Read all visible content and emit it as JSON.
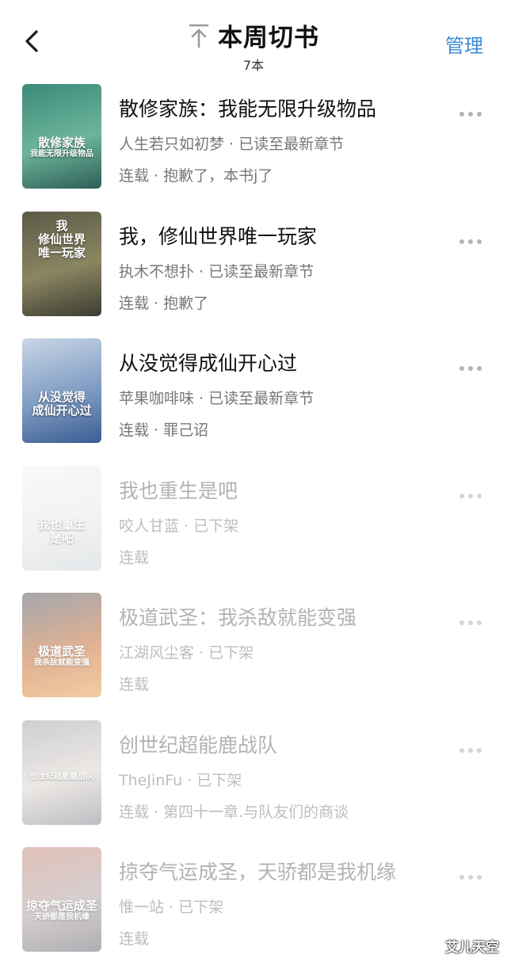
{
  "header": {
    "title": "本周切书",
    "subtitle": "7本",
    "manage_label": "管理"
  },
  "books": [
    {
      "title": "散修家族：我能无限升级物品",
      "meta": "人生若只如初梦 · 已读至最新章节",
      "status": "连载 · 抱歉了，本书j了",
      "cover": {
        "colors": [
          "#3c8a7a",
          "#6cb59a",
          "#2f5e57"
        ],
        "lines": [
          "散修家族",
          "我能无限升级物品"
        ]
      },
      "available": true
    },
    {
      "title": "我，修仙世界唯一玩家",
      "meta": "执木不想扑 · 已读至最新章节",
      "status": "连载 · 抱歉了",
      "cover": {
        "colors": [
          "#5b5a47",
          "#8a8662",
          "#3d3c30"
        ],
        "lines": [
          "我",
          "修仙世界",
          "唯一玩家"
        ]
      },
      "available": true
    },
    {
      "title": "从没觉得成仙开心过",
      "meta": "苹果咖啡味 · 已读至最新章节",
      "status": "连载 · 罪己诏",
      "cover": {
        "colors": [
          "#c9d6e6",
          "#7f9cc3",
          "#3b5d93"
        ],
        "lines": [
          "从没觉得",
          "成仙开心过"
        ]
      },
      "available": true
    },
    {
      "title": "我也重生是吧",
      "meta": "咬人甘蓝 · 已下架",
      "status": "连载",
      "cover": {
        "colors": [
          "#f2f3f4",
          "#e7e9eb",
          "#cfd4d8"
        ],
        "lines": [
          "我也重生",
          "是吧"
        ]
      },
      "available": false
    },
    {
      "title": "极道武圣：我杀敌就能变强",
      "meta": "江湖风尘客 · 已下架",
      "status": "连载",
      "cover": {
        "colors": [
          "#5a5f6a",
          "#c7723a",
          "#e8a35c"
        ],
        "lines": [
          "极道武圣",
          "我杀敌就能变强"
        ]
      },
      "available": false
    },
    {
      "title": "创世纪超能鹿战队",
      "meta": "TheJinFu · 已下架",
      "status": "连载 · 第四十一章.与队友们的商谈",
      "cover": {
        "colors": [
          "#a9a7ad",
          "#dcd6d0",
          "#8b8890"
        ],
        "lines": [
          "创世纪超能鹿战队"
        ]
      },
      "available": false
    },
    {
      "title": "掠夺气运成圣，天骄都是我机缘",
      "meta": "惟一站 · 已下架",
      "status": "连载",
      "cover": {
        "colors": [
          "#c98f7f",
          "#b4a7a8",
          "#6f6e76"
        ],
        "lines": [
          "掠夺气运成圣",
          "天骄都是我机缘"
        ]
      },
      "available": false
    }
  ],
  "watermark": "艾儿天空",
  "colors": {
    "accent": "#3a8ad8",
    "title_text": "#111111",
    "meta_text": "#777777",
    "faded_text": "#b3b3b3"
  }
}
